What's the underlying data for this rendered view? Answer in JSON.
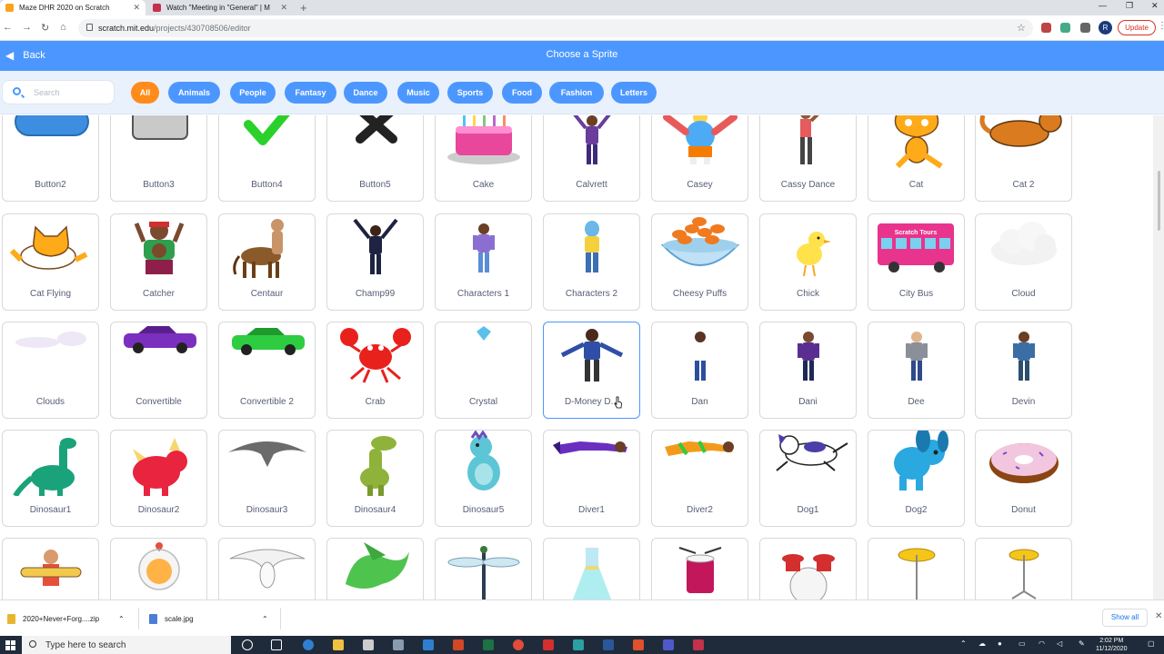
{
  "browser": {
    "tabs": [
      {
        "title": "Maze DHR 2020 on Scratch",
        "active": true
      },
      {
        "title": "Watch \"Meeting in \"General\" | M",
        "active": false
      }
    ],
    "url_host": "scratch.mit.edu",
    "url_path": "/projects/430708506/editor",
    "profile_initial": "R",
    "update_label": "Update"
  },
  "header": {
    "back_label": "Back",
    "title": "Choose a Sprite"
  },
  "search": {
    "placeholder": "Search"
  },
  "categories": [
    "All",
    "Animals",
    "People",
    "Fantasy",
    "Dance",
    "Music",
    "Sports",
    "Food",
    "Fashion",
    "Letters"
  ],
  "active_category": "All",
  "sprites": [
    "Button2",
    "Button3",
    "Button4",
    "Button5",
    "Cake",
    "Calvrett",
    "Casey",
    "Cassy Dance",
    "Cat",
    "Cat 2",
    "Cat Flying",
    "Catcher",
    "Centaur",
    "Champ99",
    "Characters 1",
    "Characters 2",
    "Cheesy Puffs",
    "Chick",
    "City Bus",
    "Cloud",
    "Clouds",
    "Convertible",
    "Convertible 2",
    "Crab",
    "Crystal",
    "D-Money D...",
    "Dan",
    "Dani",
    "Dee",
    "Devin",
    "Dinosaur1",
    "Dinosaur2",
    "Dinosaur3",
    "Dinosaur4",
    "Dinosaur5",
    "Diver1",
    "Diver2",
    "Dog1",
    "Dog2",
    "Donut",
    "",
    "",
    "",
    "",
    "",
    "",
    "",
    "",
    "",
    ""
  ],
  "selected_sprite": "D-Money D...",
  "city_bus_sign": "Scratch Tours",
  "downloads": [
    {
      "name": "2020+Never+Forg....zip"
    },
    {
      "name": "scale.jpg"
    }
  ],
  "downloads_show_all": "Show all",
  "taskbar": {
    "search_placeholder": "Type here to search",
    "time": "2:02 PM",
    "date": "11/12/2020"
  }
}
